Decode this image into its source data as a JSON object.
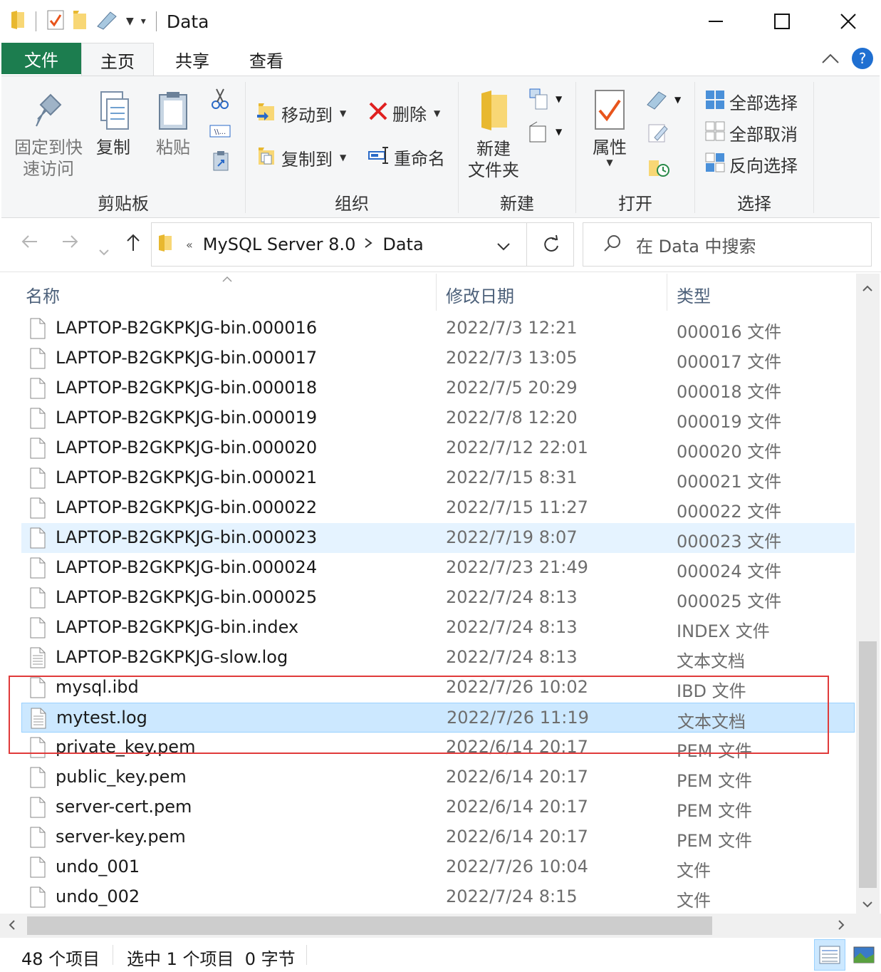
{
  "window": {
    "title": "Data"
  },
  "ribbon_tabs": {
    "file": "文件",
    "home": "主页",
    "share": "共享",
    "view": "查看"
  },
  "clipboard": {
    "pin_line1": "固定到快",
    "pin_line2": "速访问",
    "copy": "复制",
    "paste": "粘贴",
    "group": "剪贴板"
  },
  "organize": {
    "move_to": "移动到",
    "copy_to": "复制到",
    "delete": "删除",
    "rename": "重命名",
    "group": "组织"
  },
  "new": {
    "new_folder_line1": "新建",
    "new_folder_line2": "文件夹",
    "group": "新建"
  },
  "open": {
    "properties": "属性",
    "group": "打开"
  },
  "select": {
    "select_all": "全部选择",
    "select_none": "全部取消",
    "invert": "反向选择",
    "group": "选择"
  },
  "address": {
    "overflow": "«",
    "crumb1": "MySQL Server 8.0",
    "crumb2": "Data"
  },
  "search": {
    "placeholder": "在 Data 中搜索"
  },
  "columns": {
    "name": "名称",
    "date": "修改日期",
    "type": "类型"
  },
  "files": [
    {
      "name": "LAPTOP-B2GKPKJG-bin.000016",
      "date": "2022/7/3 12:21",
      "type": "000016 文件",
      "icon": "file"
    },
    {
      "name": "LAPTOP-B2GKPKJG-bin.000017",
      "date": "2022/7/3 13:05",
      "type": "000017 文件",
      "icon": "file"
    },
    {
      "name": "LAPTOP-B2GKPKJG-bin.000018",
      "date": "2022/7/5 20:29",
      "type": "000018 文件",
      "icon": "file"
    },
    {
      "name": "LAPTOP-B2GKPKJG-bin.000019",
      "date": "2022/7/8 12:20",
      "type": "000019 文件",
      "icon": "file"
    },
    {
      "name": "LAPTOP-B2GKPKJG-bin.000020",
      "date": "2022/7/12 22:01",
      "type": "000020 文件",
      "icon": "file"
    },
    {
      "name": "LAPTOP-B2GKPKJG-bin.000021",
      "date": "2022/7/15 8:31",
      "type": "000021 文件",
      "icon": "file"
    },
    {
      "name": "LAPTOP-B2GKPKJG-bin.000022",
      "date": "2022/7/15 11:27",
      "type": "000022 文件",
      "icon": "file"
    },
    {
      "name": "LAPTOP-B2GKPKJG-bin.000023",
      "date": "2022/7/19 8:07",
      "type": "000023 文件",
      "icon": "file",
      "state": "hover"
    },
    {
      "name": "LAPTOP-B2GKPKJG-bin.000024",
      "date": "2022/7/23 21:49",
      "type": "000024 文件",
      "icon": "file"
    },
    {
      "name": "LAPTOP-B2GKPKJG-bin.000025",
      "date": "2022/7/24 8:13",
      "type": "000025 文件",
      "icon": "file"
    },
    {
      "name": "LAPTOP-B2GKPKJG-bin.index",
      "date": "2022/7/24 8:13",
      "type": "INDEX 文件",
      "icon": "file"
    },
    {
      "name": "LAPTOP-B2GKPKJG-slow.log",
      "date": "2022/7/24 8:13",
      "type": "文本文档",
      "icon": "text"
    },
    {
      "name": "mysql.ibd",
      "date": "2022/7/26 10:02",
      "type": "IBD 文件",
      "icon": "file"
    },
    {
      "name": "mytest.log",
      "date": "2022/7/26 11:19",
      "type": "文本文档",
      "icon": "text",
      "state": "selected"
    },
    {
      "name": "private_key.pem",
      "date": "2022/6/14 20:17",
      "type": "PEM 文件",
      "icon": "file"
    },
    {
      "name": "public_key.pem",
      "date": "2022/6/14 20:17",
      "type": "PEM 文件",
      "icon": "file"
    },
    {
      "name": "server-cert.pem",
      "date": "2022/6/14 20:17",
      "type": "PEM 文件",
      "icon": "file"
    },
    {
      "name": "server-key.pem",
      "date": "2022/6/14 20:17",
      "type": "PEM 文件",
      "icon": "file"
    },
    {
      "name": "undo_001",
      "date": "2022/7/26 10:04",
      "type": "文件",
      "icon": "file"
    },
    {
      "name": "undo_002",
      "date": "2022/7/24 8:15",
      "type": "文件",
      "icon": "file"
    }
  ],
  "status": {
    "count": "48 个项目",
    "selection": "选中 1 个项目  0 字节"
  },
  "colors": {
    "file_tab": "#1c7d4f",
    "selected_row": "#cce8ff",
    "hover_row": "#e5f3ff",
    "annotation_box": "#e03a3a"
  }
}
